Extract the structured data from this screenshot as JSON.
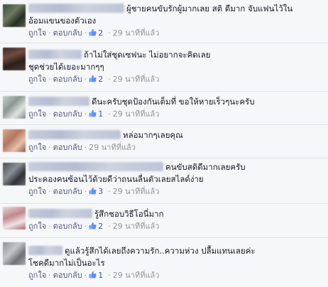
{
  "ui": {
    "like_label": "ถูกใจ",
    "reply_label": "ตอบกลับ",
    "separator": "·",
    "like_color": "#5890ff"
  },
  "comments": [
    {
      "text": "ผู้ชายคนขับรักผู้มากเลย สติ ดีมาก จับแฟนไว้ใน",
      "continuation": "อ้อมแขนของตัวเอง",
      "likes": "2",
      "time": "29 นาทีที่แล้ว"
    },
    {
      "text": "ถ้าไม่ใส่ชุดเซฟนะ ไม่อยากจะคิดเลย",
      "continuation": "ชุดช่วยได้เยอะมากๆๆ",
      "likes": "2",
      "time": "29 นาทีที่แล้ว"
    },
    {
      "text": "ดีนะครับชุดป้องกันเต็มที่ ขอให้หายเร็วๆนะครับ",
      "continuation": "",
      "likes": "1",
      "time": "29 นาทีที่แล้ว"
    },
    {
      "text": "หล่อมากๆเลยคุณ",
      "continuation": "",
      "likes": "",
      "time": "29 นาทีที่แล้ว"
    },
    {
      "text": "คนขับสติดีมากเลยครับ",
      "continuation": "ประคองคนซ้อนไว้ด้วยดีว่าถนนลื่นตัวเลยสไลด์ง่าย",
      "likes": "3",
      "time": "29 นาทีที่แล้ว"
    },
    {
      "text": "รู้สึกชอบวิธีโอนี่มาก",
      "continuation": "",
      "likes": "2",
      "time": "29 นาทีที่แล้ว"
    },
    {
      "text": "ดูแล้วรู้สึกได้เลยถึงความรัก..ความห่วง ปลื้มแทนเลยค่ะ",
      "continuation": "โชคดีมากไม่เป็นอะไร",
      "likes": "1",
      "time": "29 นาทีที่แล้ว"
    }
  ]
}
